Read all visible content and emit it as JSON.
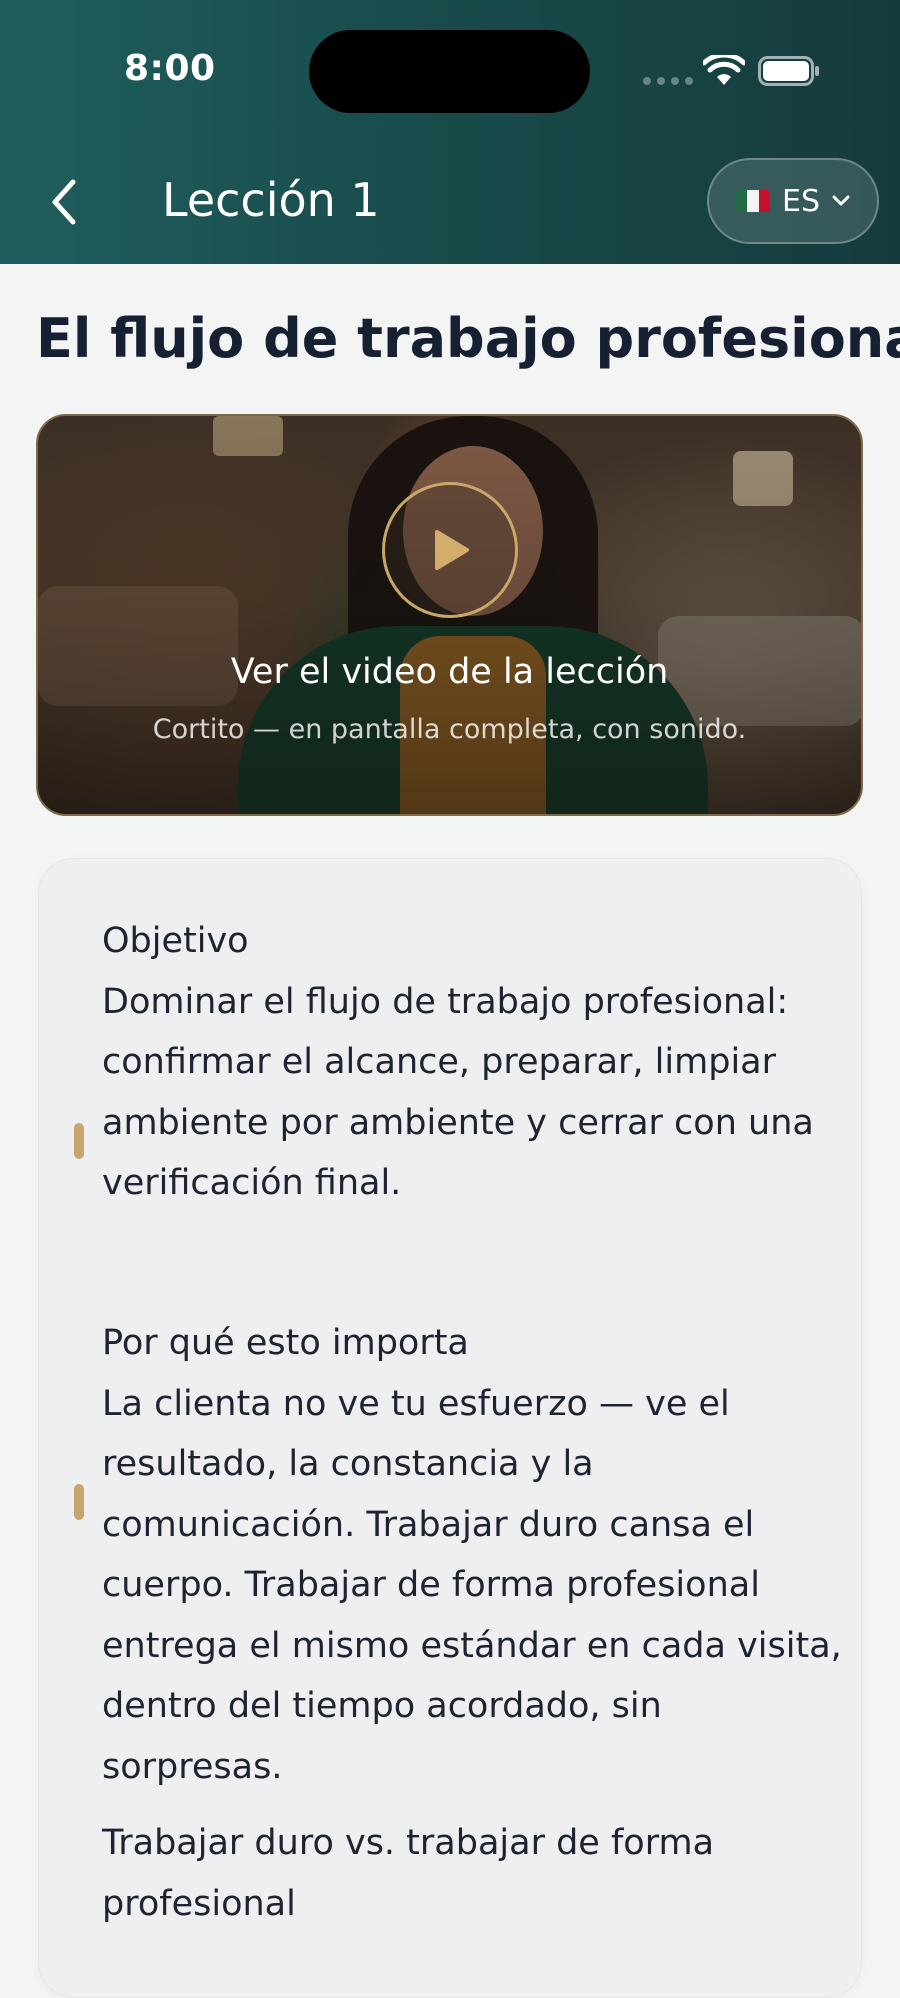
{
  "status_bar": {
    "time": "8:00"
  },
  "nav": {
    "back_icon": "chevron-left-icon",
    "title": "Lección 1",
    "language": {
      "code": "ES",
      "flag": "mexico-flag-icon",
      "dropdown_icon": "chevron-down-icon"
    }
  },
  "page": {
    "title": "El flujo de trabajo profesional"
  },
  "video": {
    "title": "Ver el video de la lección",
    "subtitle": "Cortito — en pantalla completa, con sonido.",
    "play_icon": "play-icon"
  },
  "lesson": {
    "sections": [
      {
        "heading": "Objetivo",
        "body": "Dominar el flujo de trabajo profesional: confirmar el alcance, preparar, limpiar ambiente por ambiente y cerrar con una verificación final."
      },
      {
        "heading": "Por qué esto importa",
        "body": "La clienta no ve tu esfuerzo — ve el resultado, la constancia y la comunicación. Trabajar duro cansa el cuerpo. Trabajar de forma profesional entrega el mismo estándar en cada visita, dentro del tiempo acordado, sin sorpresas."
      },
      {
        "heading": "Trabajar duro vs. trabajar de forma profesional",
        "body": ""
      }
    ]
  },
  "colors": {
    "header_start": "#1f5e5d",
    "header_end": "#163b3e",
    "accent_gold": "#c8a46e",
    "card_bg": "#efeff1",
    "page_bg": "#f3f4f4"
  }
}
